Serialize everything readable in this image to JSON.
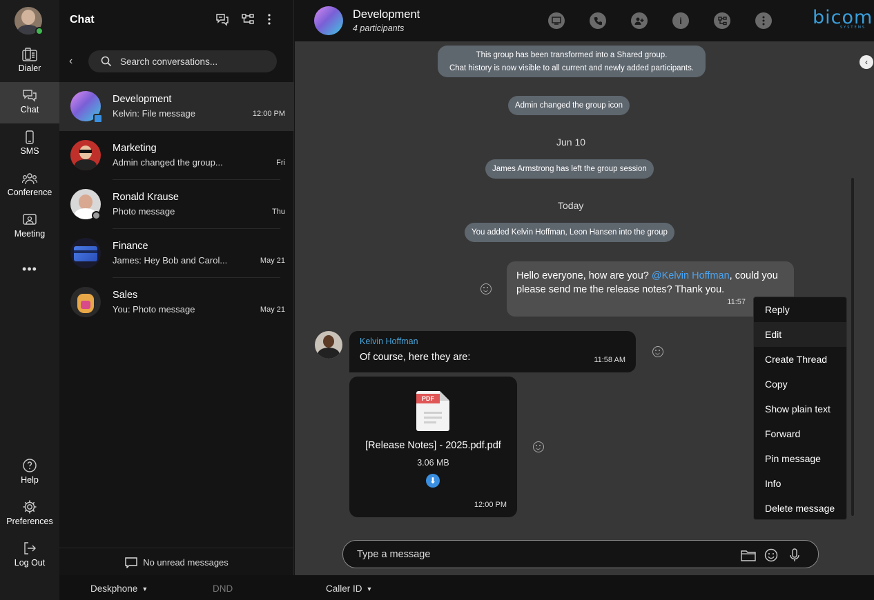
{
  "nav": {
    "items": [
      {
        "label": "Dialer",
        "icon": "dialer-icon"
      },
      {
        "label": "Chat",
        "icon": "chat-icon"
      },
      {
        "label": "SMS",
        "icon": "sms-icon"
      },
      {
        "label": "Conference",
        "icon": "conference-icon"
      },
      {
        "label": "Meeting",
        "icon": "meeting-icon"
      }
    ],
    "more": "•••",
    "bottom": [
      {
        "label": "Help",
        "icon": "help-icon"
      },
      {
        "label": "Preferences",
        "icon": "gear-icon"
      },
      {
        "label": "Log Out",
        "icon": "logout-icon"
      }
    ],
    "accent": "#3fb950"
  },
  "list": {
    "title": "Chat",
    "back": "‹",
    "search_placeholder": "Search conversations...",
    "conversations": [
      {
        "name": "Development",
        "preview": "Kelvin: File message",
        "time": "12:00 PM"
      },
      {
        "name": "Marketing",
        "preview": "Admin changed the group...",
        "time": "Fri"
      },
      {
        "name": "Ronald Krause",
        "preview": "Photo message",
        "time": "Thu"
      },
      {
        "name": "Finance",
        "preview": "James: Hey Bob and Carol...",
        "time": "May 21"
      },
      {
        "name": "Sales",
        "preview": "You: Photo message",
        "time": "May 21"
      }
    ],
    "unread": "No unread messages"
  },
  "bottombar": {
    "device": "Deskphone",
    "dnd": "DND",
    "caller_id": "Caller ID",
    "caret": "▼"
  },
  "header": {
    "title": "Development",
    "subtitle": "4 participants",
    "logo": "bicom",
    "logo_sub": "SYSTEMS",
    "info": "i"
  },
  "messages": {
    "system1_line1": "This group has been transformed into a Shared group.",
    "system1_line2": "Chat history is now visible to all current and newly added participants.",
    "system2": "Admin changed the group icon",
    "date1": "Jun 10",
    "system3": "James Armstrong has left the group session",
    "date2": "Today",
    "system4": "You added Kelvin Hoffman, Leon Hansen into the group",
    "out_text_1": "Hello everyone, how are you? ",
    "out_mention": "@Kelvin Hoffman",
    "out_text_2": ", could you please send me the release notes? Thank you.",
    "out_time": "11:57",
    "in_sender": "Kelvin Hoffman",
    "in_text": "Of course, here they are:",
    "in_time": "11:58 AM",
    "file_label": "PDF",
    "file_name": "[Release Notes] - 2025.pdf.pdf",
    "file_size": "3.06 MB",
    "file_time": "12:00 PM",
    "download": "⬇"
  },
  "context_menu": [
    "Reply",
    "Edit",
    "Create Thread",
    "Copy",
    "Show plain text",
    "Forward",
    "Pin message",
    "Info",
    "Delete message"
  ],
  "composer": {
    "placeholder": "Type a message"
  },
  "collapse": "‹"
}
